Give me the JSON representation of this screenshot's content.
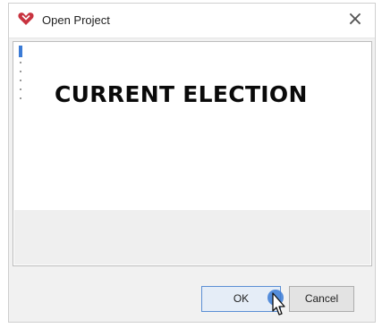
{
  "dialog": {
    "title": "Open Project",
    "close_glyph": "×",
    "icon": "app-logo-icon"
  },
  "project_list": {
    "items": [
      {
        "label": "CURRENT ELECTION",
        "selected": true
      }
    ]
  },
  "buttons": {
    "ok_label": "OK",
    "cancel_label": "Cancel"
  },
  "colors": {
    "accent": "#3b7bd6",
    "logo": "#c8333f"
  }
}
